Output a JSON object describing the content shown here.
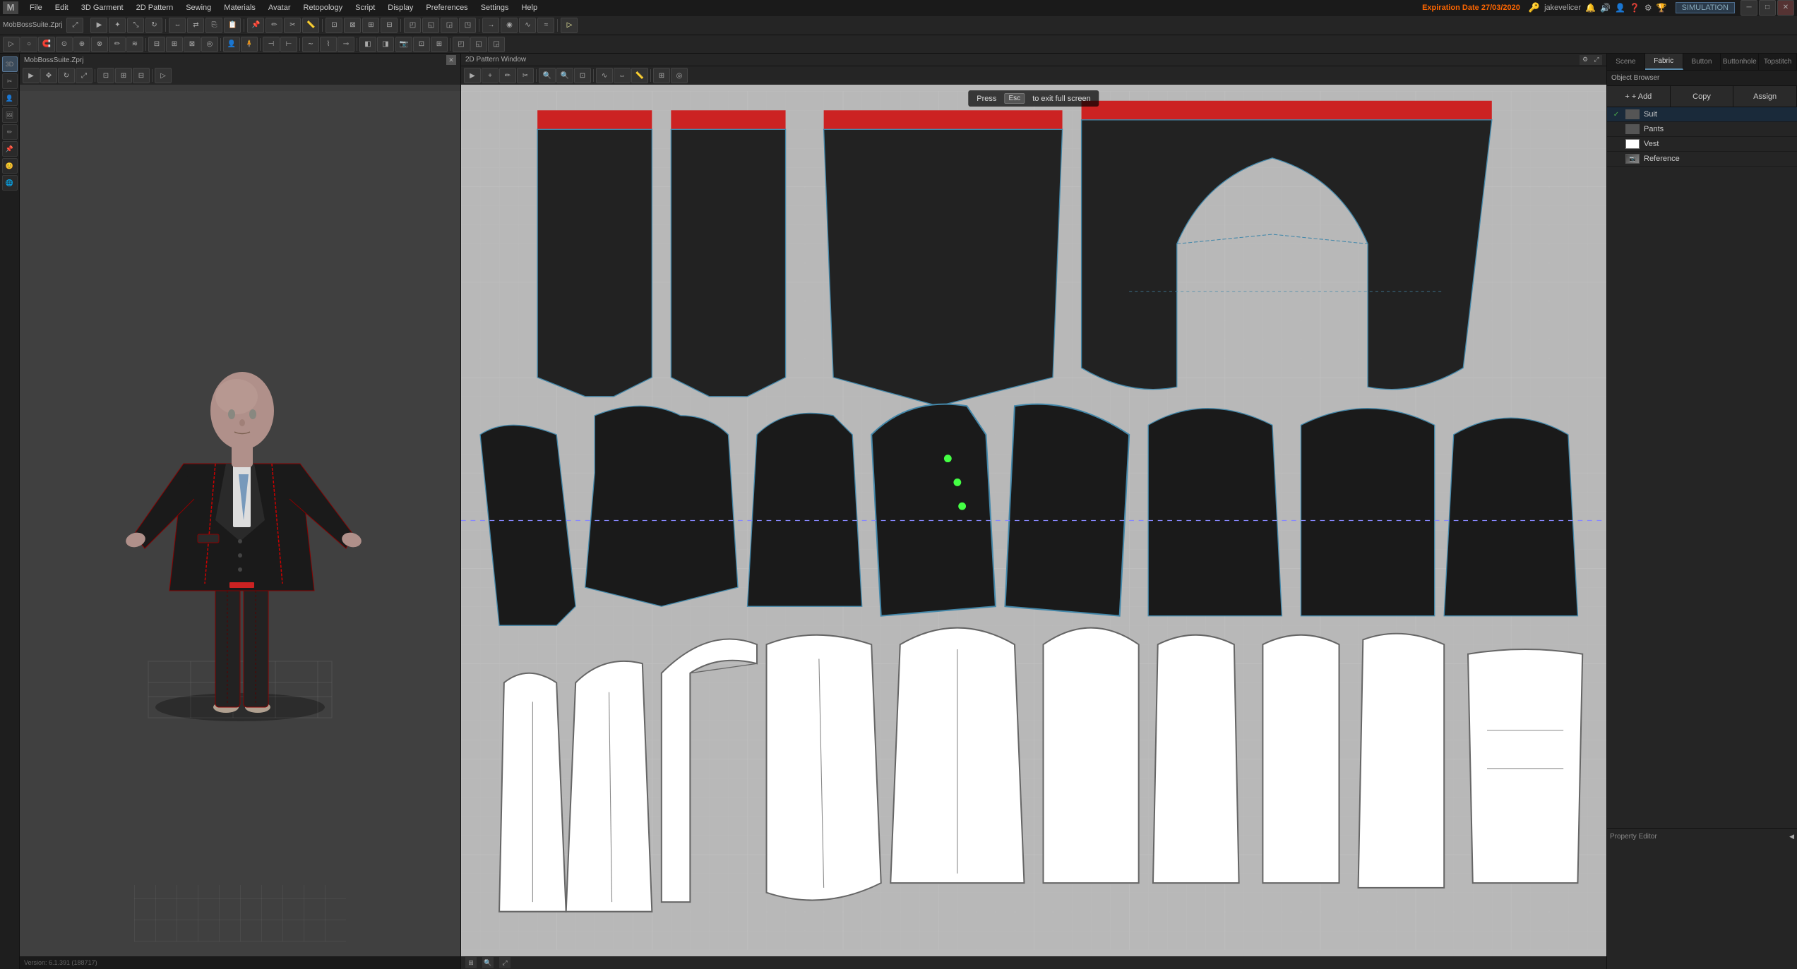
{
  "app": {
    "title": "MobBossSuite.Zprj",
    "logo": "M",
    "version": "Version: 6.1.391 (188717)"
  },
  "expiry": {
    "label": "Expiration Date",
    "date": "27/03/2020"
  },
  "user": {
    "name": "jakevelicer"
  },
  "sim_badge": "SIMULATION",
  "menu_items": [
    "File",
    "Edit",
    "3D Garment",
    "2D Pattern",
    "Sewing",
    "Materials",
    "Avatar",
    "Retopology",
    "Script",
    "Display",
    "Preferences",
    "Settings",
    "Help"
  ],
  "esc_message": {
    "press": "Press",
    "key": "Esc",
    "text": "to exit full screen"
  },
  "pattern_window": {
    "title": "2D Pattern Window"
  },
  "right_panel": {
    "tabs": [
      "Scene",
      "Fabric",
      "Button",
      "Buttonhole",
      "Topstitch"
    ],
    "active_tab": "Fabric",
    "toolbar": {
      "add_label": "+ Add",
      "copy_label": "Copy",
      "assign_label": "Assign"
    },
    "objects": [
      {
        "id": "suit",
        "name": "Suit",
        "checked": true,
        "swatch_color": "#555555"
      },
      {
        "id": "pants",
        "name": "Pants",
        "checked": false,
        "swatch_color": "#555555"
      },
      {
        "id": "vest",
        "name": "Vest",
        "checked": false,
        "swatch_color": "#ffffff"
      },
      {
        "id": "reference",
        "name": "Reference",
        "checked": false,
        "swatch_color": null,
        "has_image": true
      }
    ],
    "property_editor": {
      "title": "Property Editor"
    }
  },
  "icons": {
    "pointer": "▶",
    "move": "✥",
    "rotate": "↻",
    "scale": "⤢",
    "check": "✓",
    "collapse": "◀",
    "expand": "▶",
    "close": "✕",
    "settings": "⚙",
    "add": "+",
    "grid": "⊞"
  }
}
